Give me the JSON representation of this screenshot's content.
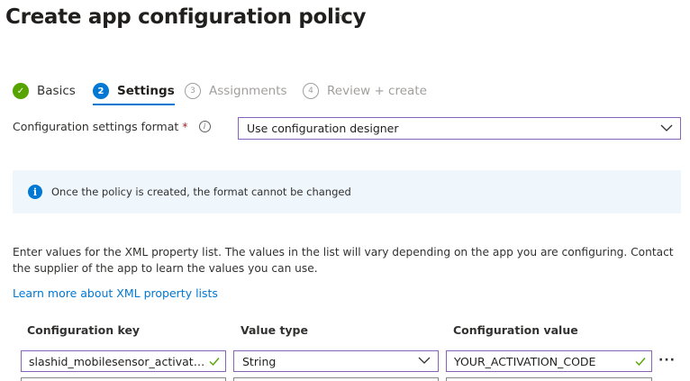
{
  "page": {
    "title": "Create app configuration policy",
    "more_label": "···"
  },
  "steps": [
    {
      "label": "Basics",
      "marker": "✓",
      "state": "done"
    },
    {
      "label": "Settings",
      "marker": "2",
      "state": "active"
    },
    {
      "label": "Assignments",
      "marker": "3",
      "state": "todo"
    },
    {
      "label": "Review + create",
      "marker": "4",
      "state": "todo"
    }
  ],
  "format": {
    "label": "Configuration settings format",
    "required_mark": "*",
    "value": "Use configuration designer"
  },
  "banner": {
    "text": "Once the policy is created, the format cannot be changed"
  },
  "description": "Enter values for the XML property list. The values in the list will vary depending on the app you are configuring. Contact the supplier of the app to learn the values you can use.",
  "learn_more": "Learn more about XML property lists",
  "table": {
    "headers": [
      "Configuration key",
      "Value type",
      "Configuration value"
    ],
    "rows": [
      {
        "key": "slashid_mobilesensor_activation_code",
        "type": "String",
        "value": "YOUR_ACTIVATION_CODE"
      }
    ],
    "row_more": "···"
  },
  "colors": {
    "accent": "#0078d4",
    "success": "#57a300",
    "focus_border": "#8764b8",
    "required": "#a4262c"
  }
}
